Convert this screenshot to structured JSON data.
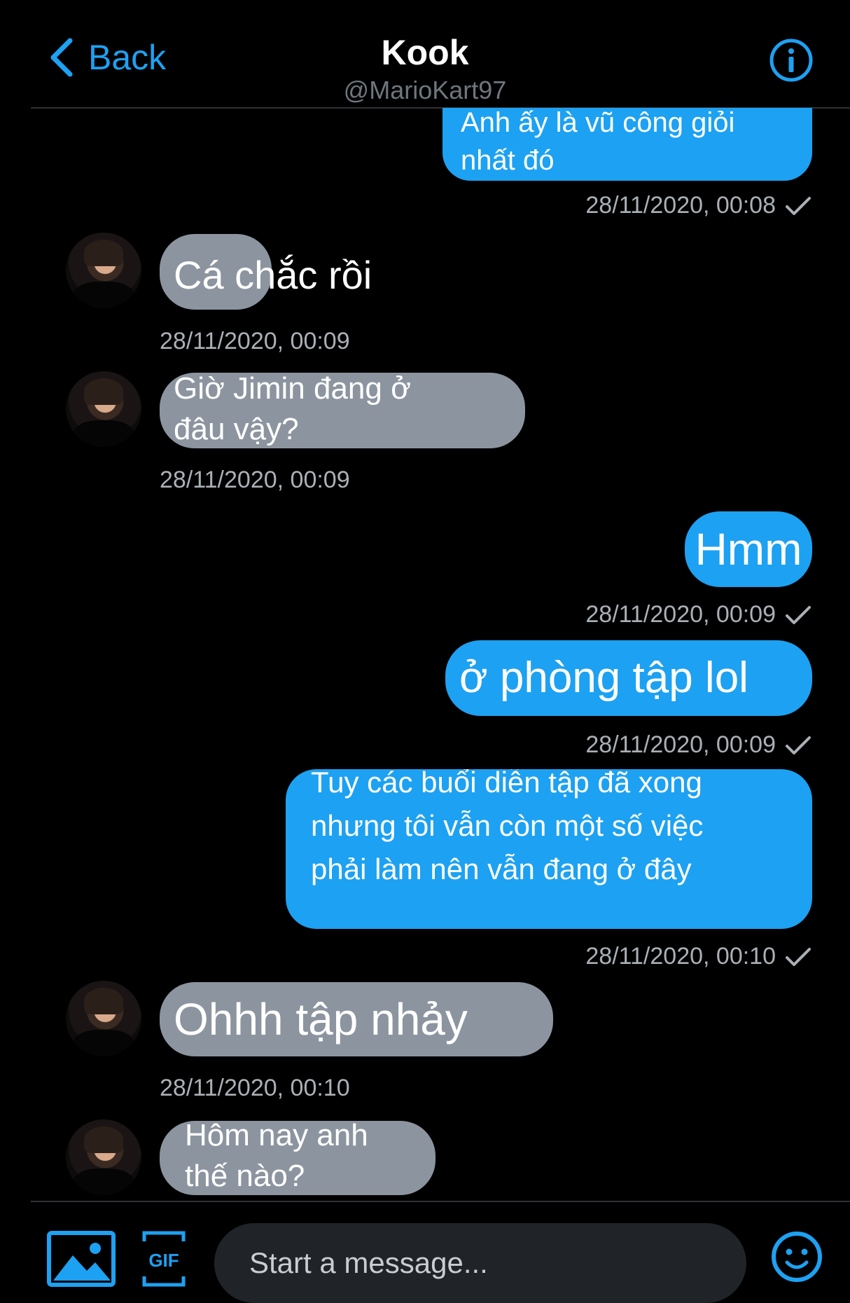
{
  "header": {
    "back_label": "Back",
    "title": "Kook",
    "handle": "@MarioKart97"
  },
  "messages": [
    {
      "direction": "sent",
      "text": "Anh ấy là vũ công giỏi nhất đó",
      "timestamp": "28/11/2020, 00:08",
      "read": true
    },
    {
      "direction": "received",
      "text": "Cá chắc rồi",
      "timestamp": "28/11/2020, 00:09"
    },
    {
      "direction": "received",
      "text": "Giờ Jimin đang ở đâu vậy?",
      "timestamp": "28/11/2020, 00:09"
    },
    {
      "direction": "sent",
      "text": "Hmm",
      "timestamp": "28/11/2020, 00:09",
      "read": true
    },
    {
      "direction": "sent",
      "text": "ở phòng tập lol",
      "timestamp": "28/11/2020, 00:09",
      "read": true
    },
    {
      "direction": "sent",
      "text": "Tuy các buổi diễn tập đã xong nhưng tôi vẫn còn một số việc phải làm nên vẫn đang ở đây",
      "timestamp": "28/11/2020, 00:10",
      "read": true
    },
    {
      "direction": "received",
      "text": "Ohhh tập nhảy",
      "timestamp": "28/11/2020, 00:10"
    },
    {
      "direction": "received",
      "text": "Hôm nay anh thế nào?"
    }
  ],
  "composer": {
    "placeholder": "Start a message...",
    "gif_label": "GIF"
  },
  "colors": {
    "accent": "#1da1f2",
    "received_bubble": "#8c959f",
    "background": "#000000"
  },
  "icons": [
    "chevron-left-icon",
    "info-icon",
    "checkmark-icon",
    "image-icon",
    "gif-icon",
    "emoji-icon"
  ]
}
